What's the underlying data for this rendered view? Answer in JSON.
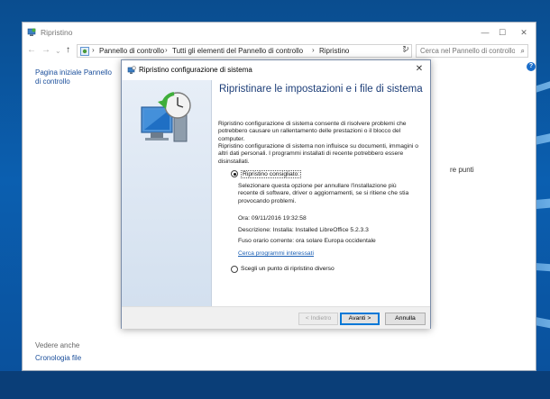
{
  "control_panel": {
    "title": "Ripristino",
    "breadcrumbs": [
      "Pannello di controllo",
      "Tutti gli elementi del Pannello di controllo",
      "Ripristino"
    ],
    "search_placeholder": "Cerca nel Pannello di controllo",
    "left_links": {
      "home": "Pagina iniziale Pannello di controllo"
    },
    "see_also": "Vedere anche",
    "file_history": "Cronologia file",
    "background_text": "re punti"
  },
  "dialog": {
    "title": "Ripristino configurazione di sistema",
    "heading": "Ripristinare le impostazioni e i file di sistema",
    "para1": "Ripristino configurazione di sistema consente di risolvere problemi che potrebbero causare un rallentamento delle prestazioni o il blocco del computer.",
    "para2": "Ripristino configurazione di sistema non influisce su documenti, immagini o altri dati personali. I programmi installati di recente potrebbero essere disinstallati.",
    "option_recommended": "Ripristino consigliato:",
    "recommended_desc": "Selezionare questa opzione per annullare l'installazione più recente di software, driver o aggiornamenti, se si ritiene che stia provocando problemi.",
    "time_line": "Ora: 09/11/2016 19:32:58",
    "description_line": "Descrizione: Installa: Installed LibreOffice 5.2.3.3",
    "timezone_line": "Fuso orario corrente: ora solare Europa occidentale",
    "affected_programs_link": "Cerca programmi interessati",
    "option_other": "Scegli un punto di ripristino diverso",
    "buttons": {
      "back": "< Indietro",
      "next": "Avanti >",
      "cancel": "Annulla"
    }
  },
  "colors": {
    "heading": "#1d3e78",
    "link": "#1a4e9b",
    "desktop": "#0b5fb0",
    "default_button_border": "#0078d7"
  }
}
